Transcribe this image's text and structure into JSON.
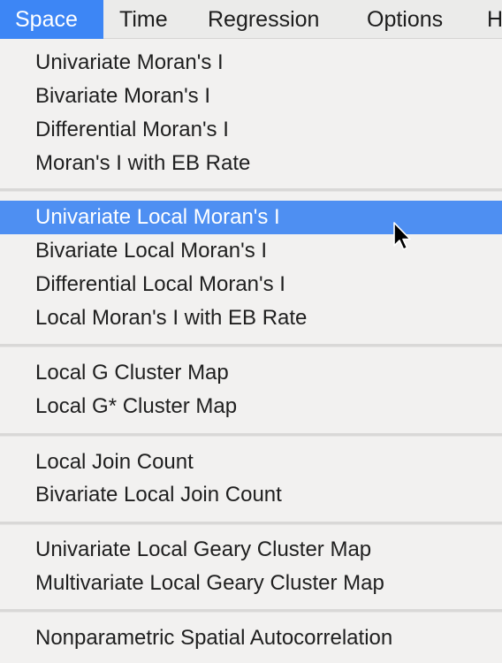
{
  "menubar": {
    "items": [
      "Space",
      "Time",
      "Regression",
      "Options",
      "H"
    ],
    "active": "Space"
  },
  "menu": {
    "groups": [
      [
        "Univariate Moran's I",
        "Bivariate Moran's I",
        "Differential Moran's I",
        "Moran's I with EB Rate"
      ],
      [
        "Univariate Local Moran's I",
        "Bivariate Local Moran's I",
        "Differential Local Moran's I",
        "Local Moran's I with EB Rate"
      ],
      [
        "Local G Cluster Map",
        "Local G* Cluster Map"
      ],
      [
        "Local Join Count",
        "Bivariate Local Join Count"
      ],
      [
        "Univariate Local Geary Cluster Map",
        "Multivariate Local Geary Cluster Map"
      ],
      [
        "Nonparametric Spatial Autocorrelation"
      ]
    ],
    "highlighted": "Univariate Local Moran's I"
  },
  "colors": {
    "accent": "#3d86f5",
    "highlight": "#4e8ff2",
    "background": "#f2f1f0",
    "separator": "#d9d8d7"
  },
  "icons": {
    "cursor": "arrow-cursor-icon"
  }
}
